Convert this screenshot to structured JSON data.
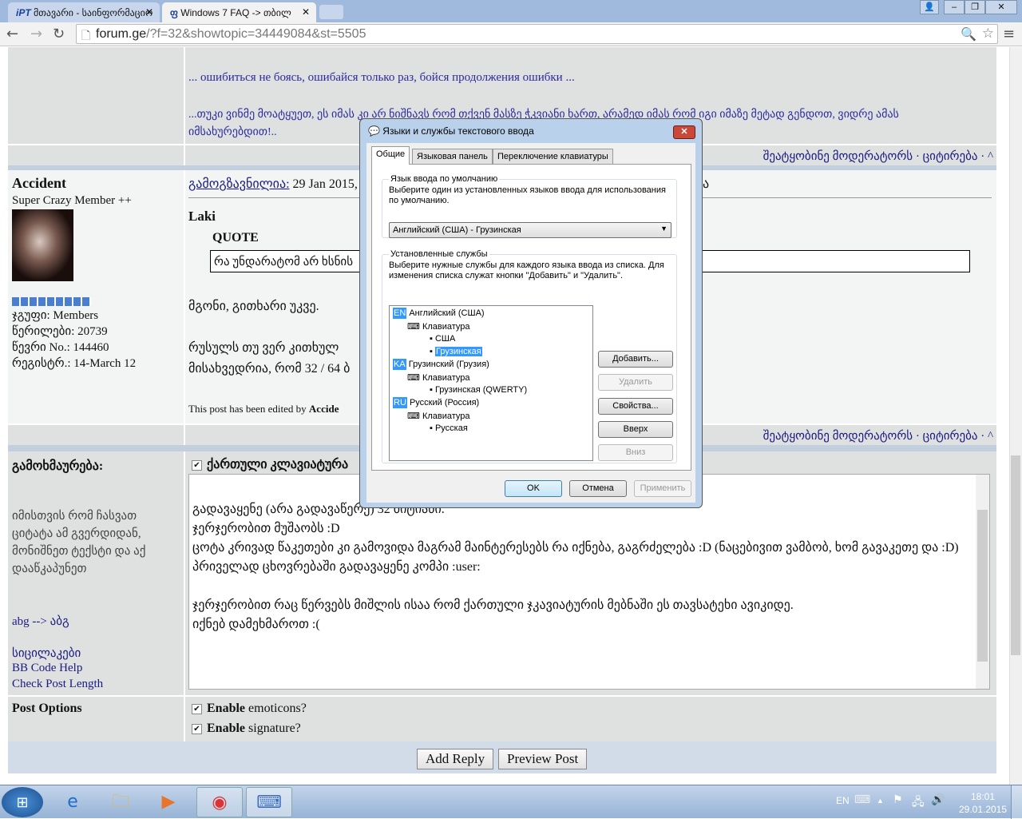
{
  "browser": {
    "tabs": [
      {
        "label": "მთავარი - საინფორმაციო",
        "icon": "iPT",
        "active": false
      },
      {
        "label": "Windows 7 FAQ -> თბილ",
        "icon": "ფ",
        "active": true
      }
    ],
    "url_host": "forum.ge",
    "url_path": "/?f=32&showtopic=34449084&st=5505"
  },
  "prev_post": {
    "signature": [
      "... ошибиться не боясь, ошибайся только раз, бойся продолжения ошибки ...",
      "...თუკი ვინმე მოატყუეთ, ეს იმას კი არ ნიშნავს რომ თქვენ მასზე ჭკვიანი ხართ, არამედ იმას რომ იგი იმაზე მეტად გენდოთ, ვიდრე ამას იმსახურებდით!.."
    ],
    "links": "შეატყობინე მოდერატორს · ციტირება · ^"
  },
  "post": {
    "author": "Accident",
    "rank": "Super Crazy Member ++",
    "stats": [
      "ჯგუფი: Members",
      "წერილები: 20739",
      "წევრი No.: 144460",
      "რეგისტრ.: 14-March 12"
    ],
    "sent_label": "გამოგზავნილია:",
    "sent_date": "29 Jan 2015,",
    "quoted_author": "Laki",
    "quote_label": "QUOTE",
    "quote_text": "რა უნდარატომ არ ხსნის",
    "body": [
      "მგონი, გითხარი უკვე.",
      "რუსულს თუ ვერ კითხულ",
      "მისახვედრია, რომ 32 / 64 ბ"
    ],
    "edited_prefix": "This post has been edited by",
    "edited_by": "Accide",
    "links": "შეატყობინე მოდერატორს · ციტირება · ^",
    "right_fragment": "ა"
  },
  "reply": {
    "label": "გამოხმაურება:",
    "help": "იმისთვის რომ ჩასვათ ციტატა ამ გვერდიდან, მონიშნეთ ტექსტი და აქ დააწკაპუნეთ",
    "translit": "abg --> აბგ",
    "tools": [
      "სიცილაკები",
      "BB Code Help",
      "Check Post Length"
    ],
    "keyboard_label": "ქართული კლავიატურა",
    "text": [
      "გადავაყენე (არა გადავაწერე) 32 ბიტიანი.",
      "ჯერჯერობით მუშაობს :D",
      "ცოტა კრივად წაკეთები კი გამოვიდა მაგრამ მაინტერესებს რა იქნება, გაგრძელება :D (ნაცებივით ვამბობ, ხომ გავაკეთე და :D)",
      "პრიველად ცხოვრებაში გადავაყენე კომპი :user:",
      "",
      "ჯერჯერობით რაც წერვებს მიშლის ისაა რომ ქართული ჯკავიატურის მებნაში ეს თავსატეხი ავიკიდე.",
      "იქნებ დამეხმაროთ :("
    ],
    "options_label": "Post Options",
    "opt1_b": "Enable",
    "opt1": " emoticons?",
    "opt2_b": "Enable",
    "opt2": " signature?",
    "add_reply": "Add Reply",
    "preview": "Preview Post"
  },
  "dialog": {
    "title": "Языки и службы текстового ввода",
    "tabs": [
      "Общие",
      "Языковая панель",
      "Переключение клавиатуры"
    ],
    "default_legend": "Язык ввода по умолчанию",
    "default_desc": "Выберите один из установленных языков ввода для использования по умолчанию.",
    "default_value": "Английский (США) - Грузинская",
    "services_legend": "Установленные службы",
    "services_desc": "Выберите нужные службы для каждого языка ввода из списка. Для изменения списка служат кнопки \"Добавить\" и \"Удалить\".",
    "tree": [
      {
        "badge": "EN",
        "lang": "Английский (США)",
        "kb": "Клавиатура",
        "layouts": [
          "США",
          "Грузинская"
        ]
      },
      {
        "badge": "KA",
        "lang": "Грузинский (Грузия)",
        "kb": "Клавиатура",
        "layouts": [
          "Грузинская (QWERTY)"
        ]
      },
      {
        "badge": "RU",
        "lang": "Русский (Россия)",
        "kb": "Клавиатура",
        "layouts": [
          "Русская"
        ]
      }
    ],
    "buttons": {
      "add": "Добавить...",
      "remove": "Удалить",
      "props": "Свойства...",
      "up": "Вверх",
      "down": "Вниз",
      "ok": "OK",
      "cancel": "Отмена",
      "apply": "Применить"
    }
  },
  "taskbar": {
    "lang": "EN",
    "time": "18:01",
    "date": "29.01.2015"
  }
}
